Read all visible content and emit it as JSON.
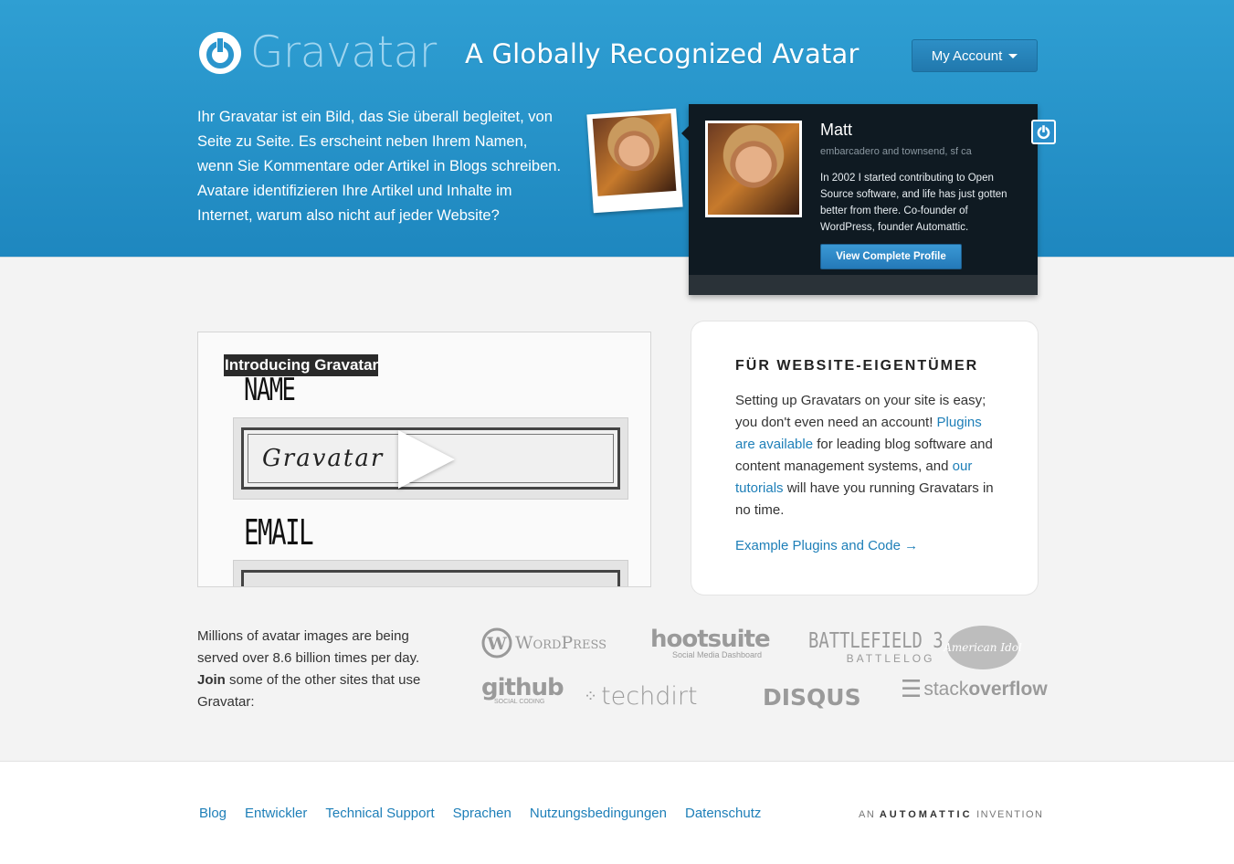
{
  "header": {
    "logo_text": "Gravatar",
    "tagline": "A Globally Recognized Avatar",
    "account_label": "My Account",
    "intro": "Ihr Gravatar ist ein Bild, das Sie überall begleitet, von Seite zu Seite. Es erscheint neben Ihrem Namen, wenn Sie Kommentare oder Artikel in Blogs schreiben. Avatare identifizieren Ihre Artikel und Inhalte im Internet, warum also nicht auf jeder Website?"
  },
  "profile": {
    "name": "Matt",
    "location": "embarcadero and townsend, sf ca",
    "bio": "In 2002 I started contributing to Open Source software, and life has just gotten better from there. Co-founder of WordPress, founder Automattic.",
    "button": "View Complete Profile"
  },
  "video": {
    "title": "Introducing Gravatar",
    "label_name": "NAME",
    "field_value": "Gravatar",
    "label_email": "EMAIL"
  },
  "owners": {
    "title": "FÜR WEBSITE-EIGENTÜMER",
    "text_1": "Setting up Gravatars on your site is easy; you don't even need an account! ",
    "link_1": "Plugins are available",
    "text_2": " for leading blog software and content management systems, and ",
    "link_2": "our tutorials",
    "text_3": " will have you running Gravatars in no time.",
    "cta": "Example Plugins and Code →"
  },
  "sites": {
    "text_1": "Millions of avatar images are being served over 8.6 billion times per day. ",
    "join": "Join",
    "text_2": " some of the other sites that use Gravatar:",
    "logos": {
      "wordpress": "WordPress",
      "hootsuite": "hootsuite",
      "hootsuite_sub": "Social Media Dashboard",
      "battlefield": "BATTLEFIELD 3",
      "battlefield_sub": "BATTLELOG",
      "idol": "American Idol",
      "github": "github",
      "github_sub": "SOCIAL CODING",
      "techdirt": "techdirt",
      "disqus": "DISQUS",
      "stack_a": "stack",
      "stack_b": "overflow"
    }
  },
  "footer": {
    "links": [
      "Blog",
      "Entwickler",
      "Technical Support",
      "Sprachen",
      "Nutzungsbedingungen",
      "Datenschutz"
    ],
    "an": "AN",
    "automattic": "AUTOMATTIC",
    "invention": "INVENTION"
  },
  "colors": {
    "brand_blue": "#1e87bf",
    "link": "#1e7fb8",
    "card_dark": "#0f1a22"
  }
}
